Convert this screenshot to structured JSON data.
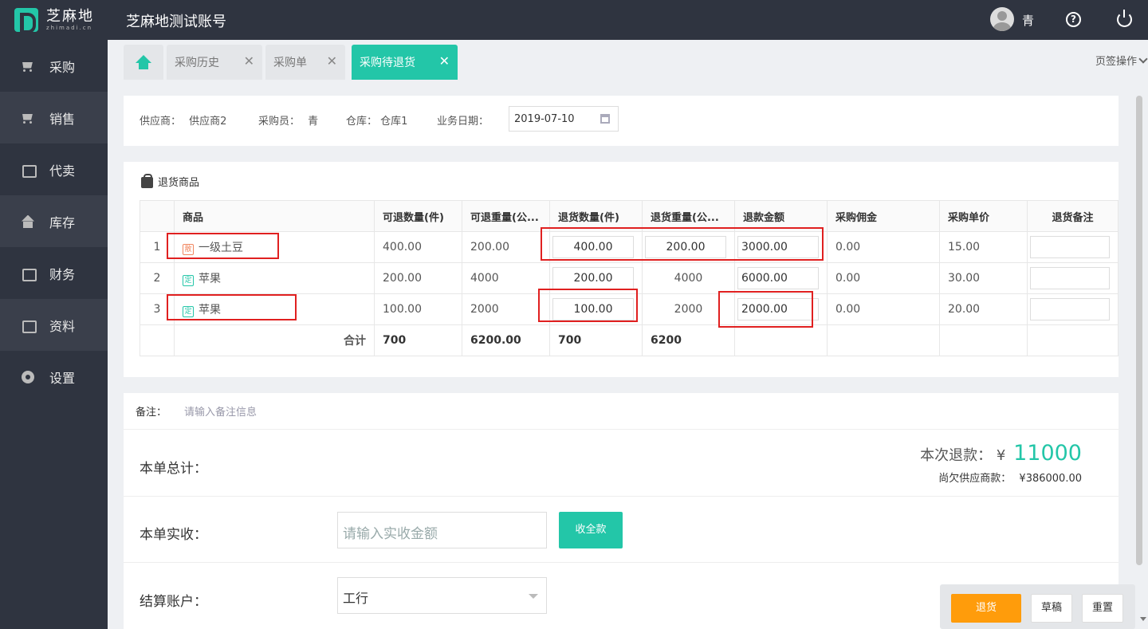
{
  "header": {
    "logo_cn": "芝麻地",
    "logo_en": "zhimadi.cn",
    "account_title": "芝麻地测试账号",
    "user_name": "青"
  },
  "sidebar": {
    "items": [
      {
        "label": "采购",
        "icon": "cart-icon"
      },
      {
        "label": "销售",
        "icon": "sales-icon"
      },
      {
        "label": "代卖",
        "icon": "consign-icon"
      },
      {
        "label": "库存",
        "icon": "warehouse-icon"
      },
      {
        "label": "财务",
        "icon": "finance-icon"
      },
      {
        "label": "资料",
        "icon": "data-icon"
      },
      {
        "label": "设置",
        "icon": "gear-icon"
      }
    ]
  },
  "tabs": {
    "items": [
      {
        "label": "采购历史"
      },
      {
        "label": "采购单"
      },
      {
        "label": "采购待退货",
        "active": true
      }
    ],
    "ops_label": "页签操作"
  },
  "info": {
    "supplier_label": "供应商：",
    "supplier": "供应商2",
    "buyer_label": "采购员：",
    "buyer": "青",
    "warehouse_label": "仓库：",
    "warehouse": "仓库1",
    "date_label": "业务日期：",
    "date": "2019-07-10"
  },
  "goods": {
    "title": "退货商品",
    "columns": [
      "商品",
      "可退数量(件)",
      "可退重量(公...",
      "退货数量(件)",
      "退货重量(公...",
      "退款金额",
      "采购佣金",
      "采购单价",
      "退货备注"
    ],
    "rows": [
      {
        "idx": "1",
        "tag": "散",
        "name": "一级土豆",
        "can_qty": "400.00",
        "can_weight": "200.00",
        "ret_qty": "400.00",
        "ret_weight": "200.00",
        "refund": "3000.00",
        "commission": "0.00",
        "unit_price": "15.00",
        "remark": ""
      },
      {
        "idx": "2",
        "tag": "定",
        "name": "苹果",
        "can_qty": "200.00",
        "can_weight": "4000",
        "ret_qty": "200.00",
        "ret_weight": "4000",
        "refund": "6000.00",
        "commission": "0.00",
        "unit_price": "30.00",
        "remark": ""
      },
      {
        "idx": "3",
        "tag": "定",
        "name": "苹果",
        "can_qty": "100.00",
        "can_weight": "2000",
        "ret_qty": "100.00",
        "ret_weight": "2000",
        "refund": "2000.00",
        "commission": "0.00",
        "unit_price": "20.00",
        "remark": ""
      }
    ],
    "sum_label": "合计",
    "sum_can_qty": "700",
    "sum_can_weight": "6200.00",
    "sum_ret_qty": "700",
    "sum_ret_weight": "6200"
  },
  "bottom": {
    "remark_label": "备注：",
    "remark_placeholder": "请输入备注信息",
    "total_label": "本单总计：",
    "refund_label": "本次退款：",
    "currency": "¥",
    "refund_amount": "11000",
    "owe_label": "尚欠供应商款：",
    "owe_amount": "¥386000.00",
    "actual_label": "本单实收：",
    "actual_placeholder": "请输入实收金额",
    "collect_all": "收全款",
    "account_label": "结算账户：",
    "account_value": "工行"
  },
  "actions": {
    "return": "退货",
    "draft": "草稿",
    "reset": "重置"
  },
  "colors": {
    "brand": "#23c6a8",
    "topbar": "#2f3440",
    "return_button": "#ff9c0b",
    "highlight": "#e02020"
  }
}
